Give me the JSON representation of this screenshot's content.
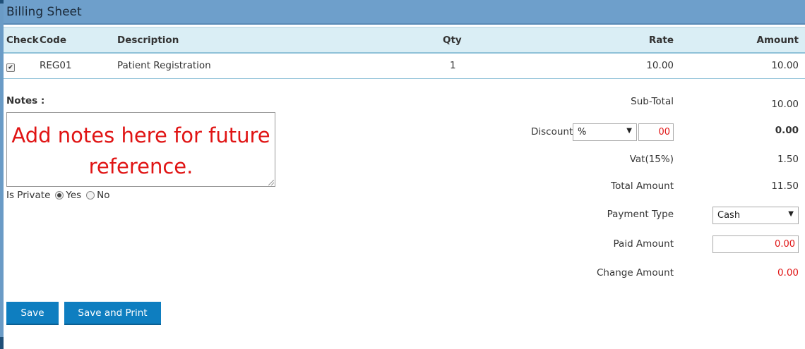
{
  "panel": {
    "title": "Billing Sheet"
  },
  "table": {
    "headers": {
      "check": "Check",
      "code": "Code",
      "description": "Description",
      "qty": "Qty",
      "rate": "Rate",
      "amount": "Amount"
    },
    "rows": [
      {
        "checked": true,
        "check_glyph": "✔",
        "code": "REG01",
        "description": "Patient Registration",
        "qty": "1",
        "rate": "10.00",
        "amount": "10.00"
      }
    ]
  },
  "notes": {
    "label": "Notes :",
    "text": "Add notes here for future reference."
  },
  "private": {
    "label": "Is Private",
    "options": [
      "Yes",
      "No"
    ],
    "selected": "Yes"
  },
  "summary": {
    "subtotal_label": "Sub-Total",
    "subtotal_value": "10.00",
    "discount_label": "Discount",
    "discount_type": "%",
    "discount_input": "00",
    "discount_value": "0.00",
    "vat_label": "Vat(15%)",
    "vat_value": "1.50",
    "total_label": "Total Amount",
    "total_value": "11.50",
    "payment_type_label": "Payment Type",
    "payment_type_value": "Cash",
    "paid_label": "Paid Amount",
    "paid_value": "0.00",
    "change_label": "Change Amount",
    "change_value": "0.00"
  },
  "buttons": {
    "save": "Save",
    "save_print": "Save and Print"
  },
  "icons": {
    "dropdown": "▼"
  },
  "colors": {
    "header_bg": "#6e9fcb",
    "table_header_bg": "#daeef5",
    "button_bg": "#0e7ec0",
    "accent_red": "#e01414"
  }
}
